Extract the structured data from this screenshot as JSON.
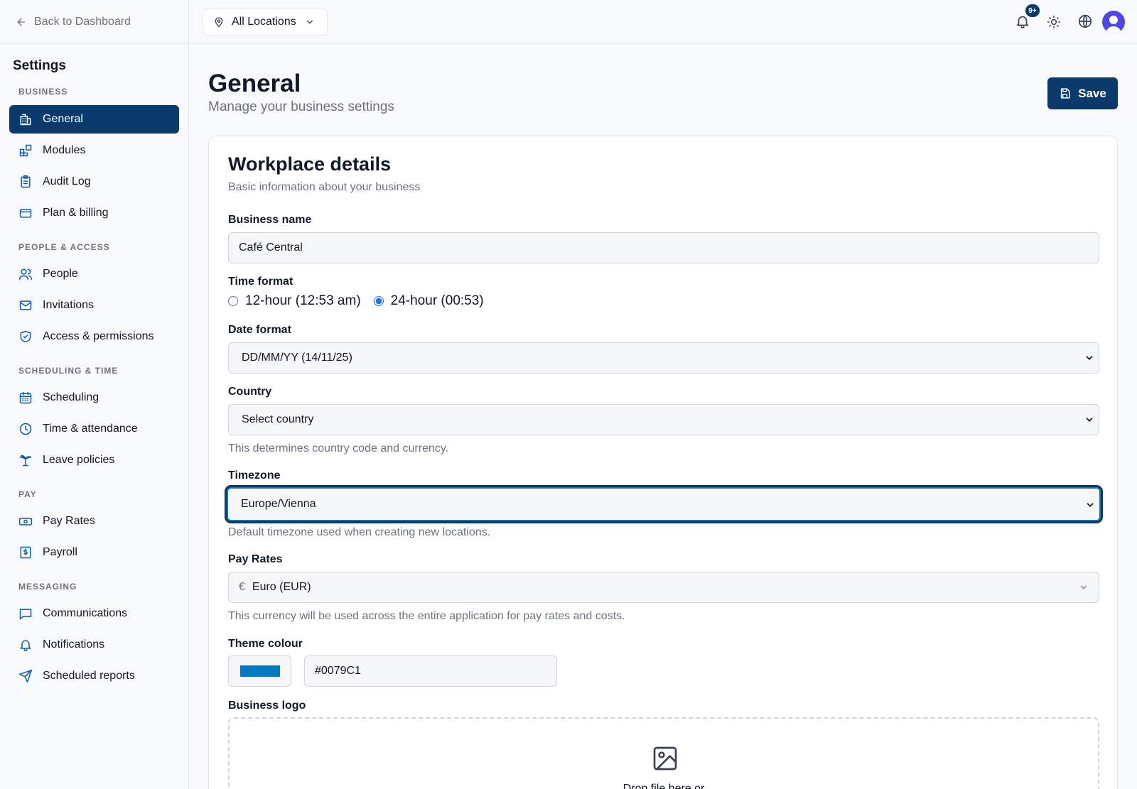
{
  "sidebar": {
    "back_label": "Back to Dashboard",
    "title": "Settings",
    "sections": {
      "business": "BUSINESS",
      "people": "PEOPLE & ACCESS",
      "scheduling": "SCHEDULING & TIME",
      "pay": "PAY",
      "messaging": "MESSAGING"
    },
    "items": {
      "general": "General",
      "modules": "Modules",
      "audit_log": "Audit Log",
      "plan_billing": "Plan & billing",
      "people": "People",
      "invitations": "Invitations",
      "access": "Access & permissions",
      "scheduling": "Scheduling",
      "time_attendance": "Time & attendance",
      "leave": "Leave policies",
      "pay_rates": "Pay Rates",
      "payroll": "Payroll",
      "communications": "Communications",
      "notifications": "Notifications",
      "scheduled_reports": "Scheduled reports"
    }
  },
  "topbar": {
    "location": "All Locations",
    "notification_badge": "9+"
  },
  "header": {
    "title": "General",
    "subtitle": "Manage your business settings",
    "save_label": "Save"
  },
  "card": {
    "title": "Workplace details",
    "subtitle": "Basic information about your business",
    "business_name_label": "Business name",
    "business_name_value": "Café Central",
    "time_format_label": "Time format",
    "time_12": "12-hour (12:53 am)",
    "time_24": "24-hour (00:53)",
    "time_selected": "24-hour",
    "date_format_label": "Date format",
    "date_format_value": "DD/MM/YY (14/11/25)",
    "country_label": "Country",
    "country_value": "Select country",
    "country_hint": "This determines country code and currency.",
    "timezone_label": "Timezone",
    "timezone_value": "Europe/Vienna",
    "timezone_hint": "Default timezone used when creating new locations.",
    "pay_rates_label": "Pay Rates",
    "currency_symbol": "€",
    "pay_rates_value": "Euro (EUR)",
    "pay_rates_hint": "This currency will be used across the entire application for pay rates and costs.",
    "theme_label": "Theme colour",
    "theme_value": "#0079C1",
    "logo_label": "Business logo",
    "logo_upload_text": "Drop file here or"
  },
  "colors": {
    "accent": "#0a3a6b",
    "theme": "#0079C1"
  }
}
